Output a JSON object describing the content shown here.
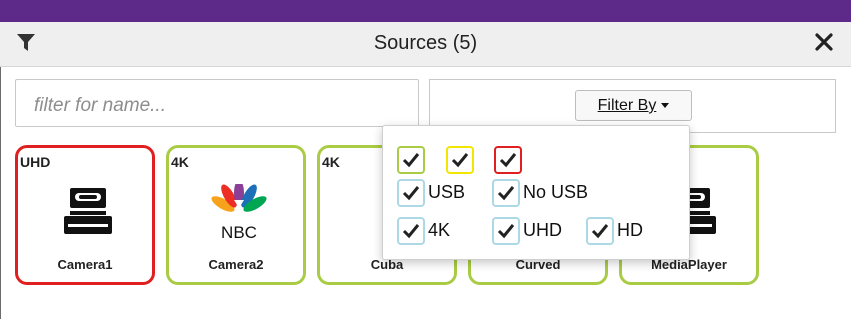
{
  "window": {
    "title": "Sources (5)"
  },
  "search": {
    "placeholder": "filter for name..."
  },
  "filter": {
    "button_label": "Filter By",
    "color_filters": [
      {
        "name": "green",
        "color": "#a9cc44",
        "checked": true
      },
      {
        "name": "yellow",
        "color": "#f2e600",
        "checked": true
      },
      {
        "name": "red",
        "color": "#e02020",
        "checked": true
      }
    ],
    "options": [
      {
        "label": "USB",
        "checked": true
      },
      {
        "label": "No USB",
        "checked": true
      },
      {
        "label": "4K",
        "checked": true
      },
      {
        "label": "UHD",
        "checked": true
      },
      {
        "label": "HD",
        "checked": true
      }
    ]
  },
  "sources": [
    {
      "name": "Camera1",
      "badge": "UHD",
      "border_color": "#e02020",
      "icon": "vhs-tape-icon"
    },
    {
      "name": "Camera2",
      "badge": "4K",
      "border_color": "#a9cc44",
      "icon": "nbc-logo-icon"
    },
    {
      "name": "Cuba",
      "badge": "4K",
      "border_color": "#a9cc44",
      "icon": "disc-logo-icon"
    },
    {
      "name": "Curved",
      "badge": "",
      "border_color": "#a9cc44",
      "icon": "vhs-tape-icon"
    },
    {
      "name": "MediaPlayer",
      "badge": "",
      "border_color": "#a9cc44",
      "icon": "vhs-tape-icon"
    }
  ],
  "logos": {
    "nbc_text": "NBC"
  },
  "colors": {
    "accent_bar": "#5e2a8a",
    "checkbox_border": "#add8e6"
  }
}
